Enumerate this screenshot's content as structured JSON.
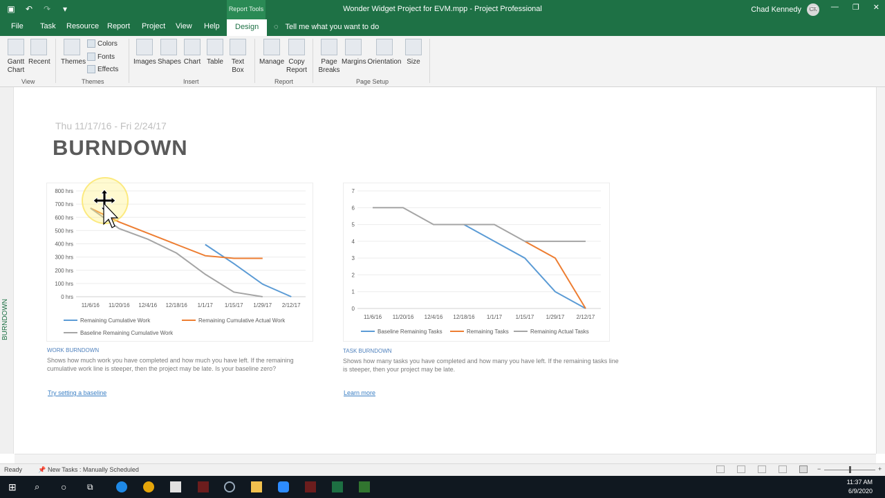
{
  "window": {
    "title": "Wonder Widget Project for EVM.mpp  -  Project Professional",
    "context_tab": "Report Tools",
    "user_name": "Chad Kennedy",
    "user_initials": "CK"
  },
  "tabs": [
    "File",
    "Task",
    "Resource",
    "Report",
    "Project",
    "View",
    "Help",
    "Design"
  ],
  "active_tab": "Design",
  "tell_me": "Tell me what you want to do",
  "ribbon": {
    "view_group": {
      "gantt": "Gantt\nChart",
      "recent": "Recent",
      "label": "View"
    },
    "themes_group": {
      "themes": "Themes",
      "colors": "Colors",
      "fonts": "Fonts",
      "effects": "Effects",
      "label": "Themes"
    },
    "insert_group": {
      "images": "Images",
      "shapes": "Shapes",
      "chart": "Chart",
      "table": "Table",
      "textbox": "Text\nBox",
      "label": "Insert"
    },
    "report_group": {
      "manage": "Manage",
      "copy": "Copy\nReport",
      "label": "Report"
    },
    "setup_group": {
      "breaks": "Page\nBreaks",
      "margins": "Margins",
      "orientation": "Orientation",
      "size": "Size",
      "label": "Page Setup"
    }
  },
  "side_label": "BURNDOWN",
  "report": {
    "dates": "Thu 11/17/16   -   Fri 2/24/17",
    "title": "BURNDOWN"
  },
  "work_chart": {
    "caption": "WORK BURNDOWN",
    "description": "Shows how much work you have completed and how much you have left. If the remaining cumulative work line is steeper, then the project may be late. Is your baseline zero?",
    "link": "Try setting a baseline"
  },
  "task_chart": {
    "caption": "TASK BURNDOWN",
    "description": "Shows how many tasks you have completed and how many you have left. If the remaining tasks line is steeper, then your project may be late.",
    "link": "Learn more"
  },
  "chart_data": [
    {
      "type": "line",
      "categories": [
        "11/6/16",
        "11/20/16",
        "12/4/16",
        "12/18/16",
        "1/1/17",
        "1/15/17",
        "1/29/17",
        "2/12/17"
      ],
      "y_ticks": [
        "0 hrs",
        "100 hrs",
        "200 hrs",
        "300 hrs",
        "400 hrs",
        "500 hrs",
        "600 hrs",
        "700 hrs",
        "800 hrs"
      ],
      "ylim": [
        0,
        800
      ],
      "grid": true,
      "legend": "bottom",
      "series": [
        {
          "name": "Remaining Cumulative Work",
          "color": "#5b9bd5",
          "values": [
            null,
            null,
            null,
            null,
            395,
            250,
            95,
            0
          ]
        },
        {
          "name": "Remaining Cumulative Actual Work",
          "color": "#ed7d31",
          "values": [
            670,
            565,
            480,
            395,
            310,
            290,
            290,
            null
          ]
        },
        {
          "name": "Baseline Remaining Cumulative Work",
          "color": "#a5a5a5",
          "values": [
            670,
            515,
            435,
            330,
            170,
            35,
            0,
            null
          ]
        }
      ]
    },
    {
      "type": "line",
      "categories": [
        "11/6/16",
        "11/20/16",
        "12/4/16",
        "12/18/16",
        "1/1/17",
        "1/15/17",
        "1/29/17",
        "2/12/17"
      ],
      "y_ticks": [
        "0",
        "1",
        "2",
        "3",
        "4",
        "5",
        "6",
        "7"
      ],
      "ylim": [
        0,
        7
      ],
      "grid": true,
      "legend": "bottom",
      "series": [
        {
          "name": "Baseline Remaining Tasks",
          "color": "#5b9bd5",
          "values": [
            null,
            null,
            null,
            5,
            4,
            3,
            1,
            0
          ]
        },
        {
          "name": "Remaining Tasks",
          "color": "#ed7d31",
          "values": [
            null,
            null,
            null,
            null,
            null,
            4,
            3,
            0
          ]
        },
        {
          "name": "Remaining Actual Tasks",
          "color": "#a5a5a5",
          "values": [
            6,
            6,
            5,
            5,
            5,
            4,
            4,
            4
          ]
        }
      ]
    }
  ],
  "status": {
    "ready": "Ready",
    "new_tasks": "New Tasks : Manually Scheduled"
  },
  "clock": {
    "time": "11:37 AM",
    "date": "6/9/2020"
  }
}
